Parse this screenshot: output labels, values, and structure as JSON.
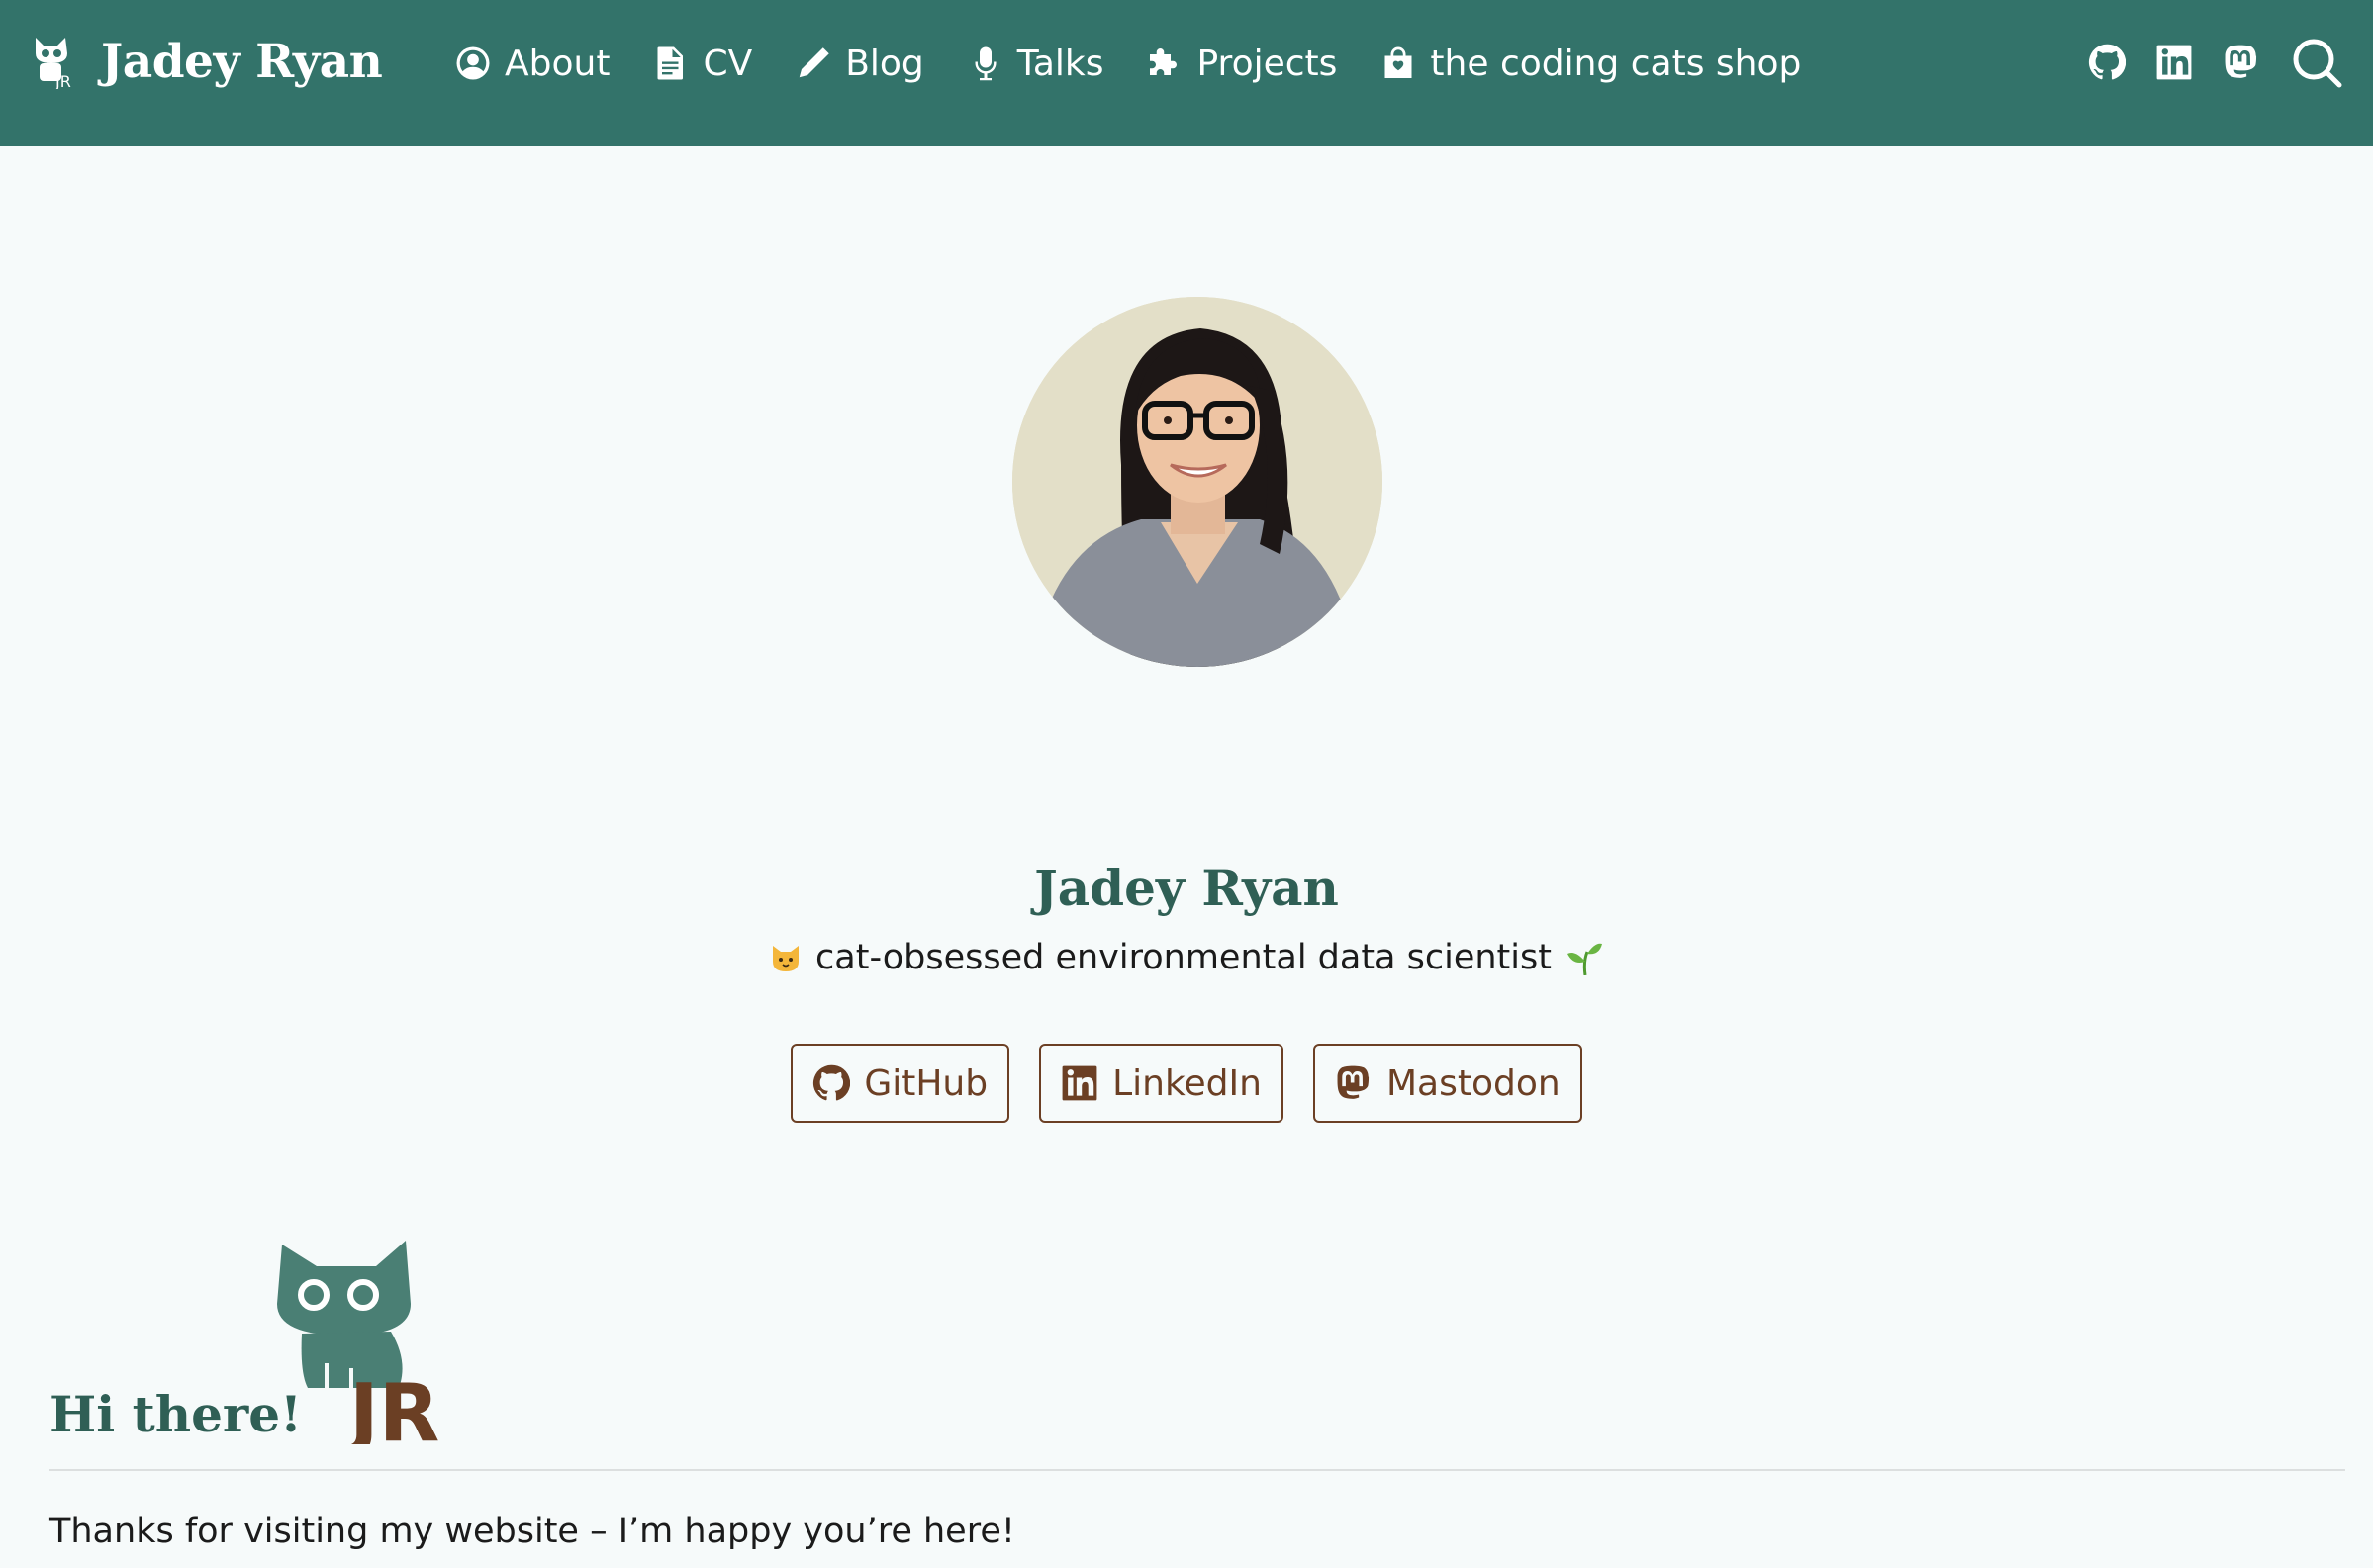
{
  "navbar": {
    "brand_name": "Jadey Ryan",
    "background": "#33736a",
    "links": [
      {
        "label": "About",
        "icon": "person-circle-icon"
      },
      {
        "label": "CV",
        "icon": "file-text-icon"
      },
      {
        "label": "Blog",
        "icon": "pencil-icon"
      },
      {
        "label": "Talks",
        "icon": "mic-icon"
      },
      {
        "label": "Projects",
        "icon": "puzzle-icon"
      },
      {
        "label": "the coding cats shop",
        "icon": "shopping-bag-icon"
      }
    ],
    "tool_icons": [
      "github-icon",
      "linkedin-icon",
      "mastodon-icon",
      "search-icon"
    ]
  },
  "hero": {
    "name": "Jadey Ryan",
    "tagline": "cat-obsessed environmental data scientist",
    "buttons": [
      {
        "label": "GitHub",
        "icon": "github-icon"
      },
      {
        "label": "LinkedIn",
        "icon": "linkedin-icon"
      },
      {
        "label": "Mastodon",
        "icon": "mastodon-icon"
      }
    ],
    "accent": "#2f5f55",
    "button_color": "#6b3f24"
  },
  "content": {
    "heading": "Hi there!",
    "logo_text": "JR",
    "intro": "Thanks for visiting my website – I’m happy you’re here!"
  }
}
